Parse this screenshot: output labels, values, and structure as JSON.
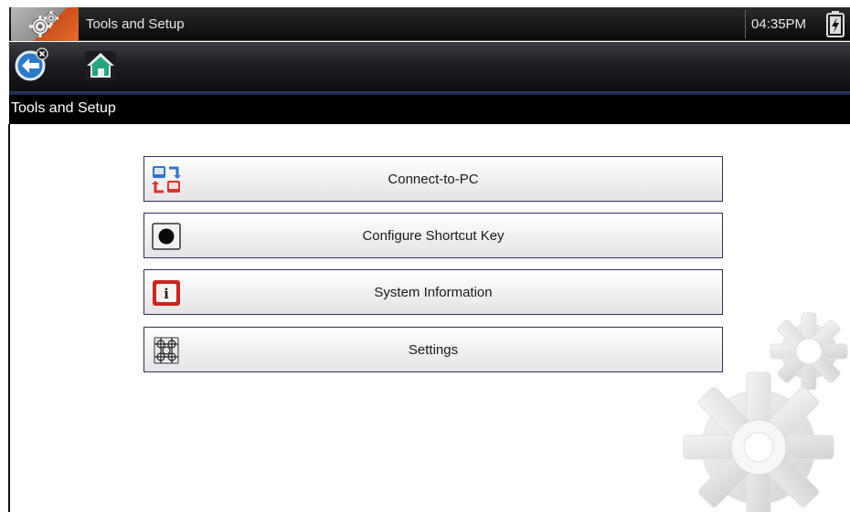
{
  "titlebar": {
    "title": "Tools and Setup",
    "time": "04:35PM",
    "app_icon": "tools-gear-icon",
    "battery_icon": "battery-charging-icon"
  },
  "toolbar": {
    "back_icon": "back-arrow-icon",
    "home_icon": "home-icon"
  },
  "header": {
    "title": "Tools and Setup"
  },
  "menu": [
    {
      "label": "Connect-to-PC",
      "icon": "connect-pc-icon"
    },
    {
      "label": "Configure Shortcut Key",
      "icon": "shortcut-key-icon"
    },
    {
      "label": "System Information",
      "icon": "info-icon"
    },
    {
      "label": "Settings",
      "icon": "settings-icon"
    }
  ],
  "colors": {
    "titlebar": "#111111",
    "toolbar_accent": "#2b3d6e",
    "button_border": "#2e2e5a"
  }
}
